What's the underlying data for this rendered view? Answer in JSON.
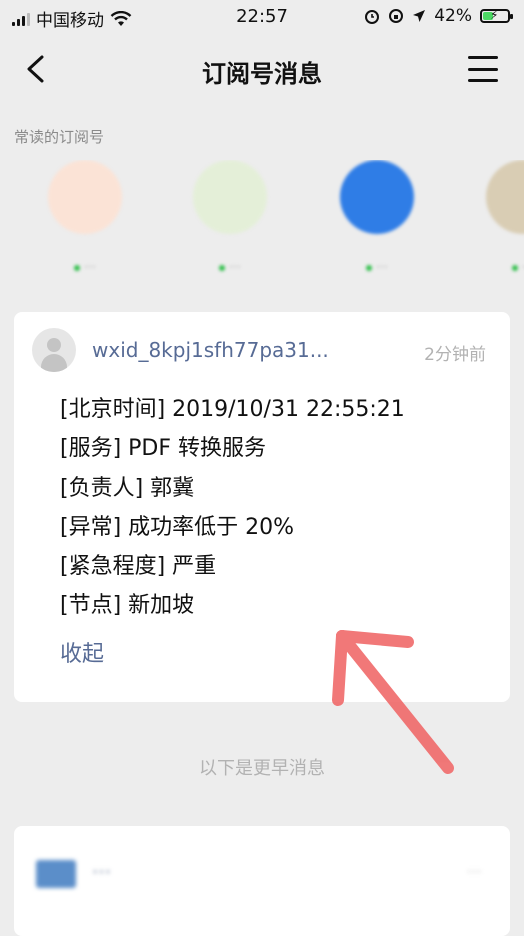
{
  "status_bar": {
    "carrier": "中国移动",
    "time": "22:57",
    "battery": "42%",
    "battery_level": 0.42
  },
  "nav": {
    "title": "订阅号消息"
  },
  "frequent": {
    "label": "常读的订阅号",
    "items": [
      {
        "name": "···",
        "color": "#f3a27a"
      },
      {
        "name": "···",
        "color": "#8bbf5a"
      },
      {
        "name": "···",
        "color": "#2f7de6"
      },
      {
        "name": "···",
        "color": "#b8a27a"
      }
    ]
  },
  "message": {
    "sender": "wxid_8kpj1sfh77pa31...",
    "time_ago": "2分钟前",
    "lines": [
      "[北京时间] 2019/10/31 22:55:21",
      "[服务] PDF 转换服务",
      "[负责人] 郭冀",
      "[异常] 成功率低于 20%",
      "[紧急程度] 严重",
      "[节点] 新加坡"
    ],
    "collapse_label": "收起"
  },
  "divider_text": "以下是更早消息",
  "earlier_card": {
    "name": "···",
    "time": "···"
  },
  "colors": {
    "link": "#576b95",
    "annotation_arrow": "#f06a6a"
  }
}
